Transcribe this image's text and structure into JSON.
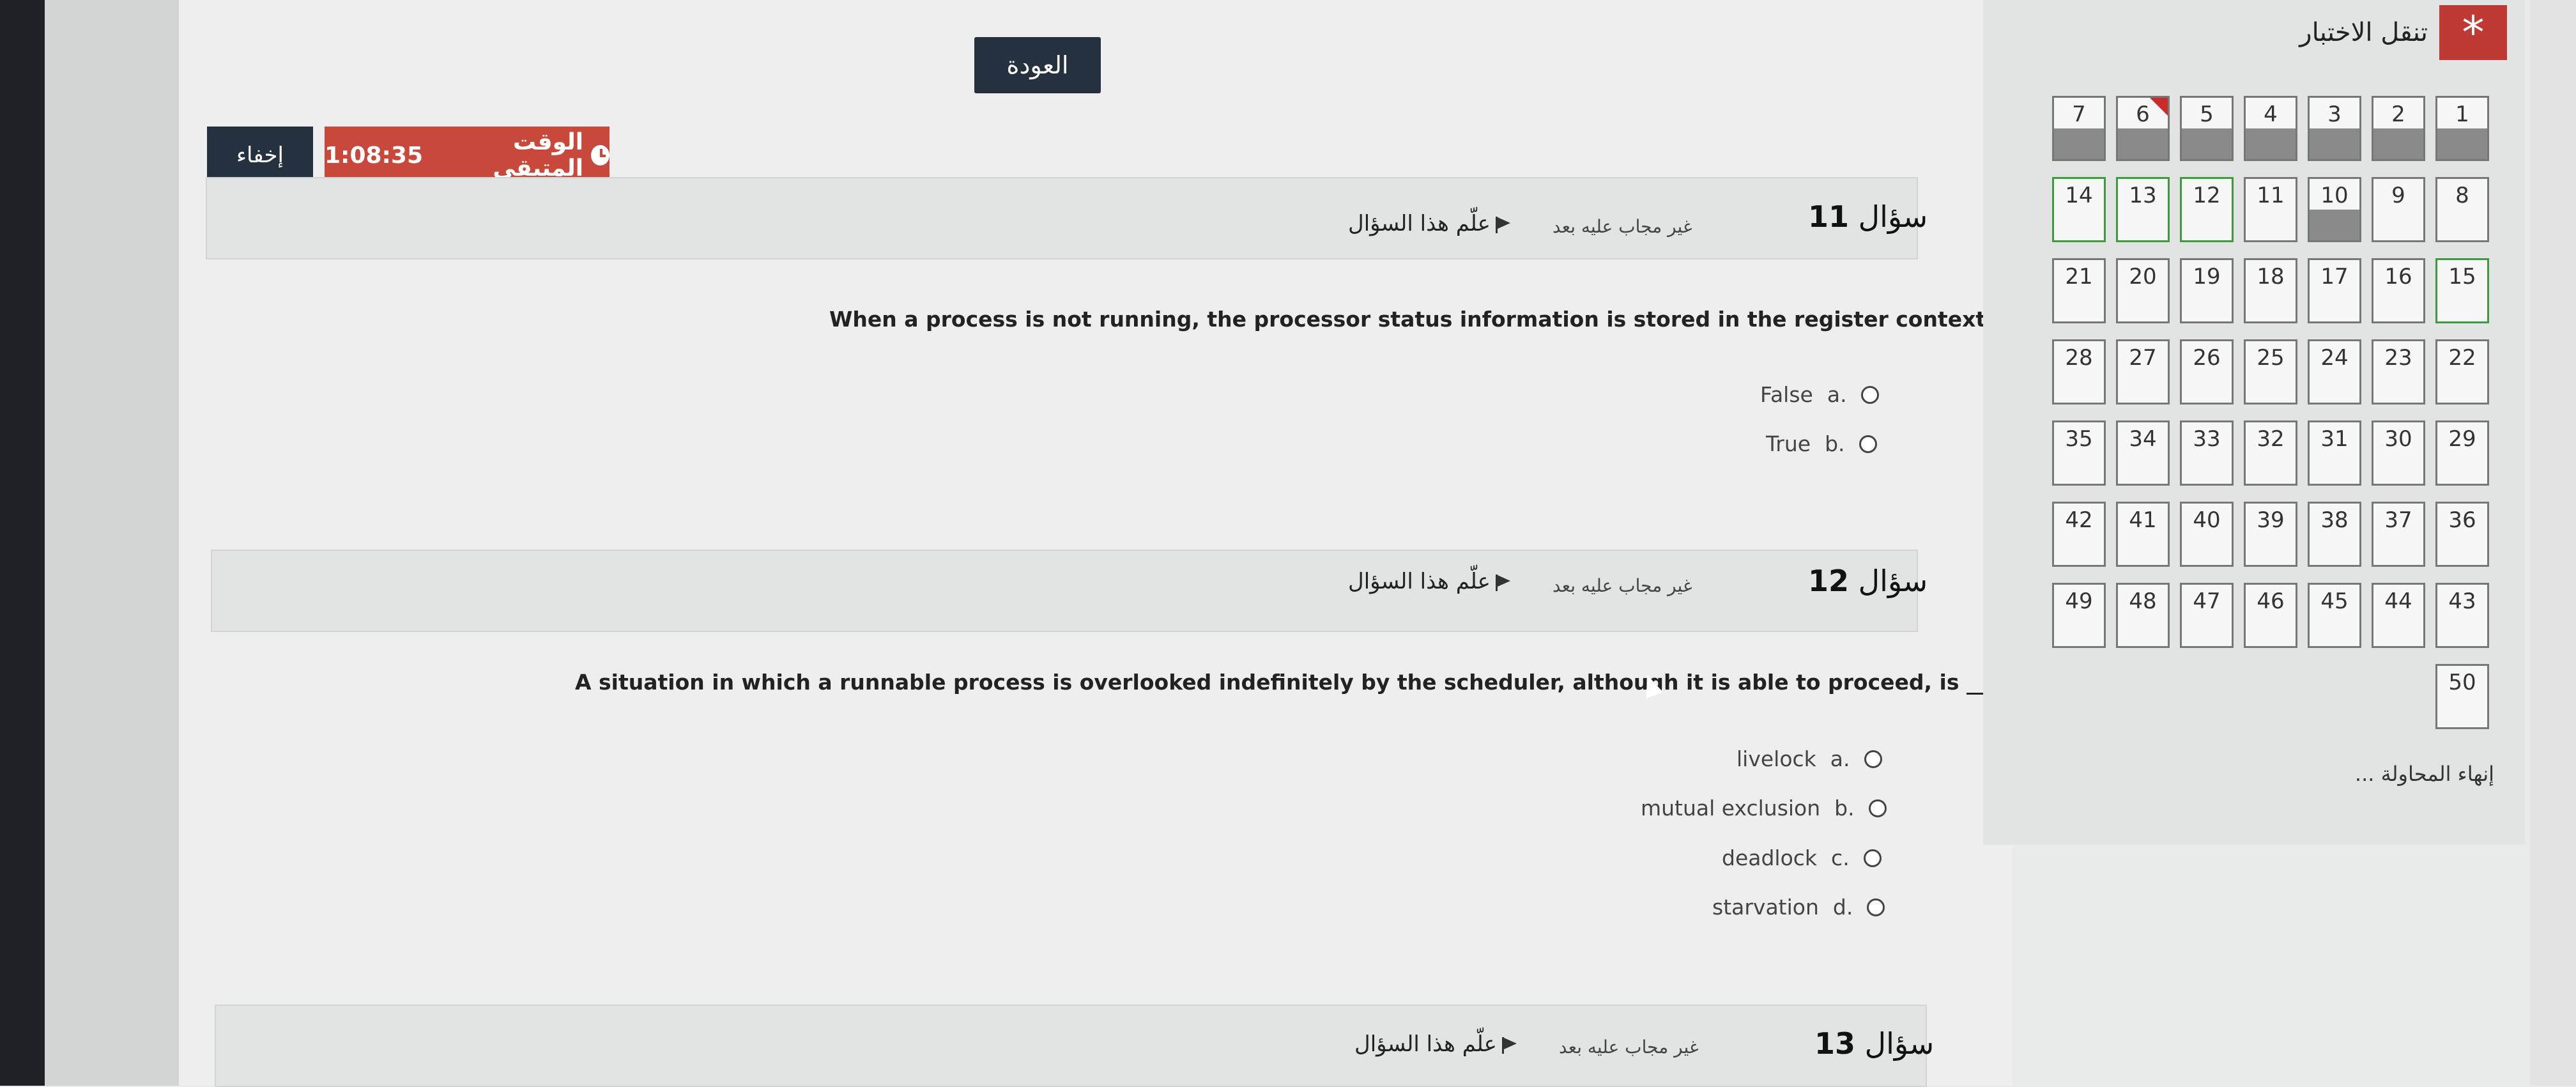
{
  "header": {
    "back_label": "العودة",
    "hide_label": "إخفاء",
    "timer_label": "الوقت المتبقي",
    "timer_value": "1:08:35"
  },
  "questions": [
    {
      "label": "سؤال",
      "number": "11",
      "state": "غير مجاب عليه بعد",
      "flag_label": "علّم هذا السؤال",
      "text": "When a process is not running, the processor status information is stored in the register context area.",
      "options": [
        {
          "letter": "a.",
          "text": "False"
        },
        {
          "letter": "b.",
          "text": "True"
        }
      ]
    },
    {
      "label": "سؤال",
      "number": "12",
      "state": "غير مجاب عليه بعد",
      "flag_label": "علّم هذا السؤال",
      "text": "A situation in which a runnable process is overlooked indefinitely by the scheduler, although it is able to proceed, is _________.",
      "options": [
        {
          "letter": "a.",
          "text": "livelock"
        },
        {
          "letter": "b.",
          "text": "mutual exclusion"
        },
        {
          "letter": "c.",
          "text": "deadlock"
        },
        {
          "letter": "d.",
          "text": "starvation"
        }
      ]
    },
    {
      "label": "سؤال",
      "number": "13",
      "state": "غير مجاب عليه بعد",
      "flag_label": "علّم هذا السؤال"
    }
  ],
  "navigation": {
    "title": "تنقل الاختبار",
    "star_icon": "asterisk-icon",
    "finish_label": "إنهاء المحاولة ...",
    "cells": [
      {
        "n": "1",
        "answered": true
      },
      {
        "n": "2",
        "answered": true
      },
      {
        "n": "3",
        "answered": true
      },
      {
        "n": "4",
        "answered": true
      },
      {
        "n": "5",
        "answered": true
      },
      {
        "n": "6",
        "answered": true,
        "flagged": true
      },
      {
        "n": "7",
        "answered": true
      },
      {
        "n": "8",
        "answered": false
      },
      {
        "n": "9",
        "answered": false
      },
      {
        "n": "10",
        "answered": true
      },
      {
        "n": "11",
        "answered": false
      },
      {
        "n": "12",
        "answered": false,
        "current": true
      },
      {
        "n": "13",
        "answered": false,
        "current": true
      },
      {
        "n": "14",
        "answered": false,
        "current": true
      },
      {
        "n": "15",
        "current": true
      },
      {
        "n": "16"
      },
      {
        "n": "17"
      },
      {
        "n": "18"
      },
      {
        "n": "19"
      },
      {
        "n": "20"
      },
      {
        "n": "21"
      },
      {
        "n": "22"
      },
      {
        "n": "23"
      },
      {
        "n": "24"
      },
      {
        "n": "25"
      },
      {
        "n": "26"
      },
      {
        "n": "27"
      },
      {
        "n": "28"
      },
      {
        "n": "29"
      },
      {
        "n": "30"
      },
      {
        "n": "31"
      },
      {
        "n": "32"
      },
      {
        "n": "33"
      },
      {
        "n": "34"
      },
      {
        "n": "35"
      },
      {
        "n": "36"
      },
      {
        "n": "37"
      },
      {
        "n": "38"
      },
      {
        "n": "39"
      },
      {
        "n": "40"
      },
      {
        "n": "41"
      },
      {
        "n": "42"
      },
      {
        "n": "43"
      },
      {
        "n": "44"
      },
      {
        "n": "45"
      },
      {
        "n": "46"
      },
      {
        "n": "47"
      },
      {
        "n": "48"
      },
      {
        "n": "49"
      },
      {
        "n": "50"
      }
    ]
  }
}
